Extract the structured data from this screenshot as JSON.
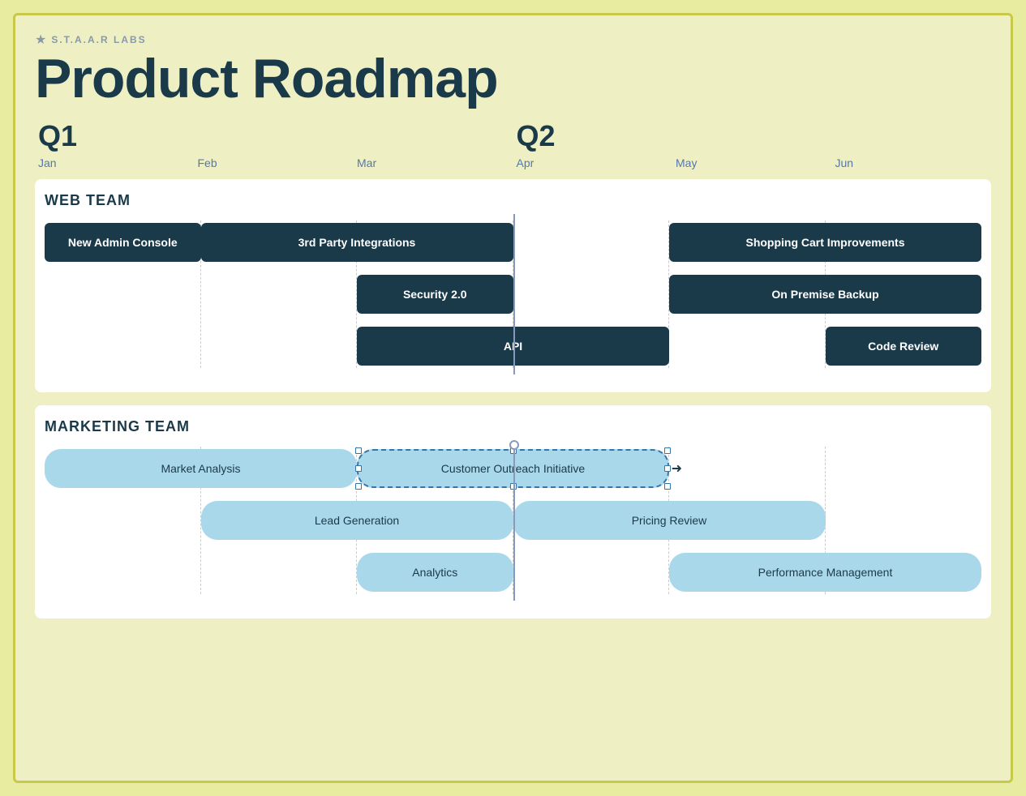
{
  "brand": {
    "star": "★",
    "name": "S.T.A.A.R LABS"
  },
  "title": "Product Roadmap",
  "quarters": [
    {
      "label": "Q1",
      "col": 1
    },
    {
      "label": "Q2",
      "col": 4
    }
  ],
  "months": [
    {
      "label": "Jan"
    },
    {
      "label": "Feb"
    },
    {
      "label": "Mar"
    },
    {
      "label": "Apr"
    },
    {
      "label": "May"
    },
    {
      "label": "Jun"
    }
  ],
  "web_team": {
    "title": "WEB TEAM",
    "bars": [
      {
        "label": "New Admin Console",
        "col": "col-1",
        "type": "dark"
      },
      {
        "label": "3rd Party Integrations",
        "col": "col-2-4",
        "type": "dark"
      },
      {
        "label": "Shopping Cart Improvements",
        "col": "col-5-7",
        "type": "dark"
      }
    ],
    "row2": [
      {
        "label": "Security 2.0",
        "col": "col-3",
        "type": "dark"
      },
      {
        "label": "On Premise Backup",
        "col": "col-5-7",
        "type": "dark"
      }
    ],
    "row3": [
      {
        "label": "API",
        "col": "col-3-5",
        "type": "dark"
      },
      {
        "label": "Code Review",
        "col": "col-6",
        "type": "dark"
      }
    ]
  },
  "marketing_team": {
    "title": "MARKETING TEAM",
    "row1": [
      {
        "label": "Market Analysis",
        "col": "col-1-3",
        "type": "light"
      },
      {
        "label": "Customer Outreach Initiative",
        "col": "col-3-5",
        "type": "selected"
      }
    ],
    "row2": [
      {
        "label": "Lead Generation",
        "col": "col-2-4",
        "type": "light"
      },
      {
        "label": "Pricing Review",
        "col": "col-4-6",
        "type": "light"
      }
    ],
    "row3": [
      {
        "label": "Analytics",
        "col": "col-3",
        "type": "light"
      },
      {
        "label": "Performance Management",
        "col": "col-5-7",
        "type": "light"
      }
    ]
  }
}
